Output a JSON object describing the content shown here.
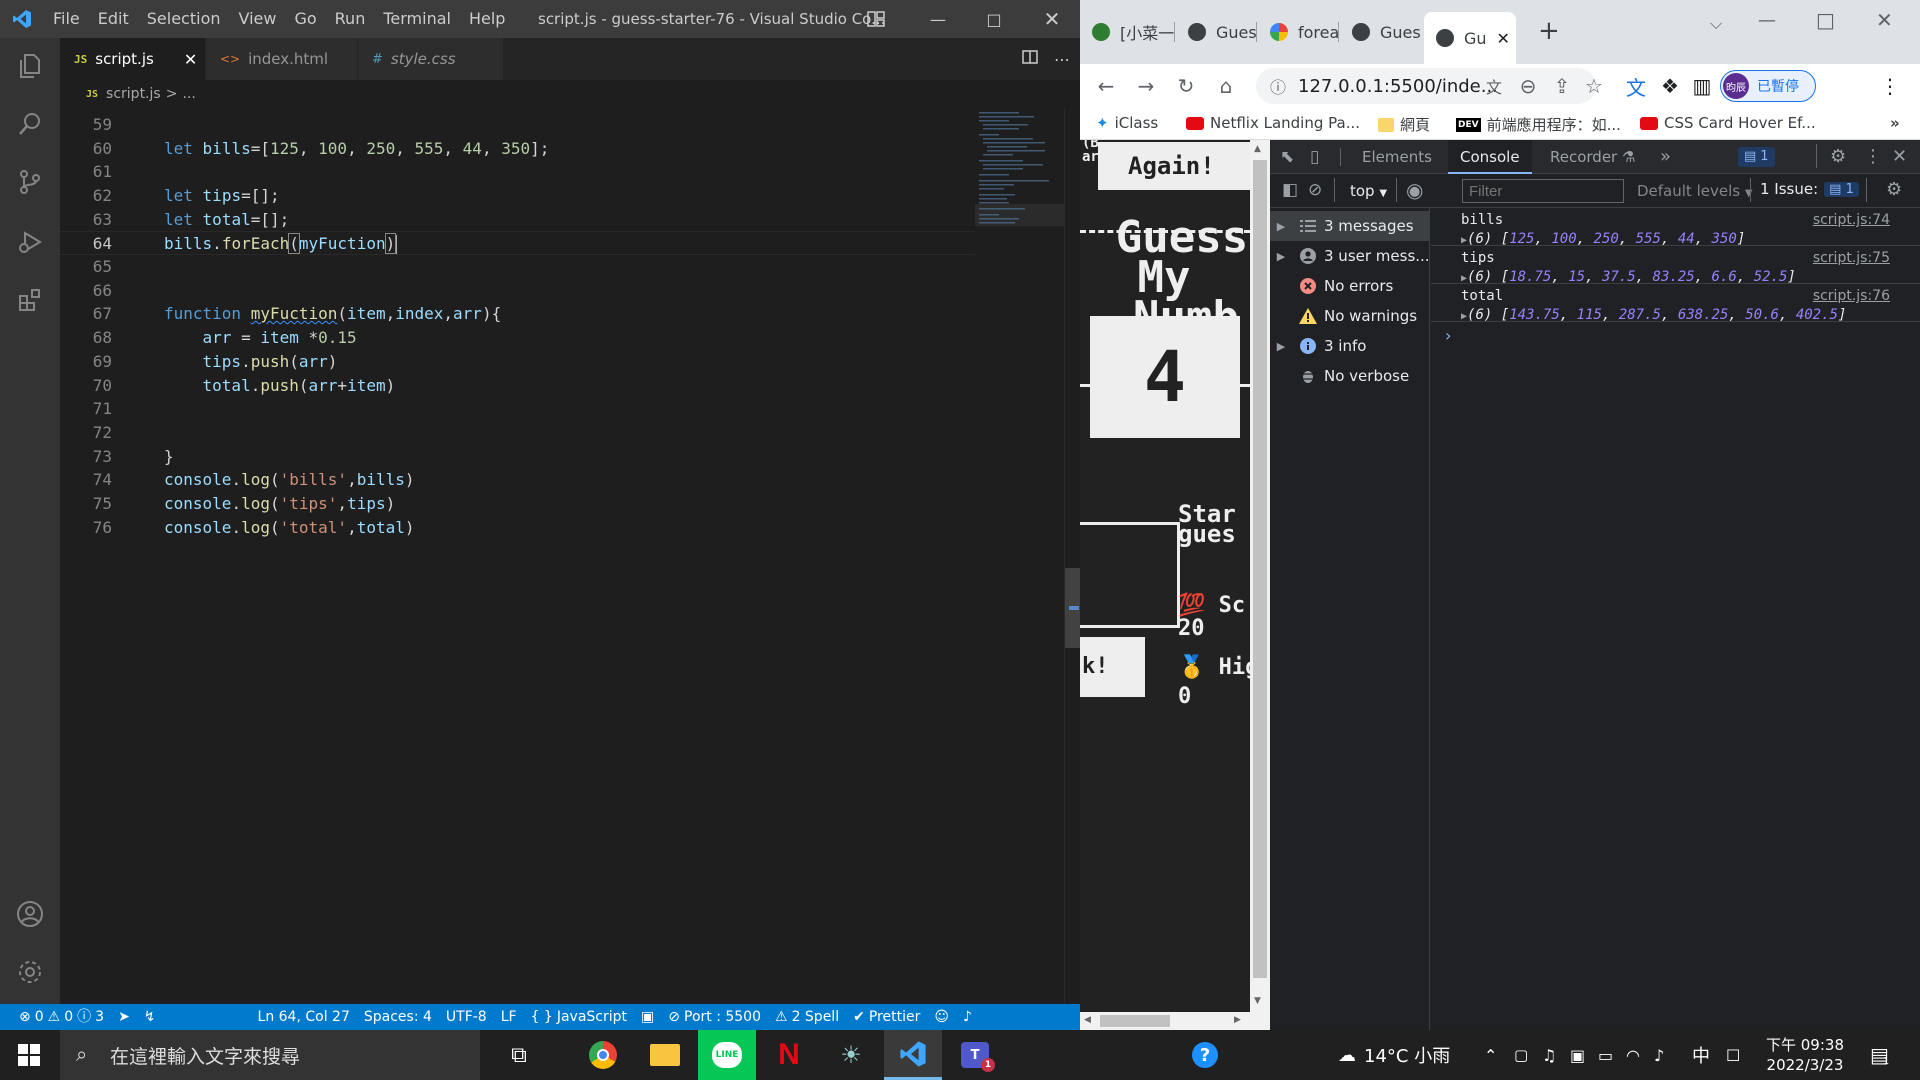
{
  "vscode": {
    "menu": [
      "File",
      "Edit",
      "Selection",
      "View",
      "Go",
      "Run",
      "Terminal",
      "Help"
    ],
    "title": "script.js - guess-starter-76 - Visual Studio Co...",
    "tabs": [
      {
        "label": "script.js",
        "type": "JS",
        "active": true
      },
      {
        "label": "index.html",
        "type": "<>",
        "active": false
      },
      {
        "label": "style.css",
        "type": "#",
        "active": false
      }
    ],
    "breadcrumb": {
      "file": "script.js",
      "sep": ">",
      "rest": "..."
    },
    "line_numbers": [
      "59",
      "60",
      "61",
      "62",
      "63",
      "64",
      "65",
      "66",
      "67",
      "68",
      "69",
      "70",
      "71",
      "72",
      "73",
      "74",
      "75",
      "76"
    ],
    "current_line": "64",
    "status": {
      "errors": "0",
      "warnings": "0",
      "info": "3",
      "position": "Ln 64, Col 27",
      "spaces": "Spaces: 4",
      "encoding": "UTF-8",
      "eol": "LF",
      "language": "JavaScript",
      "port": "Port : 5500",
      "spell": "2 Spell",
      "prettier": "Prettier"
    }
  },
  "chrome": {
    "tabs": [
      {
        "label": "[小菜一"
      },
      {
        "label": "Guess"
      },
      {
        "label": "foreac"
      },
      {
        "label": "Guess"
      },
      {
        "label": "Gu",
        "active": true
      }
    ],
    "url": "127.0.0.1:5500/inde...",
    "profile_label": "已暫停",
    "profile_avatar": "昀辰",
    "bookmarks": [
      "iClass",
      "Netflix Landing Pa...",
      "網頁",
      "前端應用程序：如...",
      "CSS Card Hover Ef..."
    ],
    "page": {
      "again_button": "Again!",
      "title_lines": [
        "Guess",
        "My",
        "Numb"
      ],
      "number_box": "4",
      "start_text": [
        "Star",
        "gues"
      ],
      "score_label": "💯 Sc",
      "score_value": "20",
      "check_button": "k!",
      "highscore_label": "🥇 High",
      "highscore_value": "0",
      "clipped_top": [
        "(B",
        "ar"
      ]
    },
    "devtools": {
      "tabs": [
        "Elements",
        "Console",
        "Recorder"
      ],
      "issues_badge": "1",
      "context": "top",
      "filter_placeholder": "Filter",
      "levels": "Default levels",
      "issues_count": "1 Issue:",
      "issues_count_badge": "1",
      "sidebar": [
        {
          "label": "3 messages",
          "arrow": true
        },
        {
          "label": "3 user mess...",
          "arrow": true
        },
        {
          "label": "No errors",
          "arrow": false
        },
        {
          "label": "No warnings",
          "arrow": false
        },
        {
          "label": "3 info",
          "arrow": true
        },
        {
          "label": "No verbose",
          "arrow": false
        }
      ],
      "logs": [
        {
          "label": "bills",
          "src": "script.js:74",
          "count": "(6)",
          "values": [
            "125",
            "100",
            "250",
            "555",
            "44",
            "350"
          ]
        },
        {
          "label": "tips",
          "src": "script.js:75",
          "count": "(6)",
          "values": [
            "18.75",
            "15",
            "37.5",
            "83.25",
            "6.6",
            "52.5"
          ]
        },
        {
          "label": "total",
          "src": "script.js:76",
          "count": "(6)",
          "values": [
            "143.75",
            "115",
            "287.5",
            "638.25",
            "50.6",
            "402.5"
          ]
        }
      ],
      "prompt": "›"
    }
  },
  "taskbar": {
    "search_placeholder": "在這裡輸入文字來搜尋",
    "weather": "14°C 小雨",
    "ime": "中",
    "time": "下午 09:38",
    "date": "2022/3/23",
    "notification_count": "1"
  }
}
